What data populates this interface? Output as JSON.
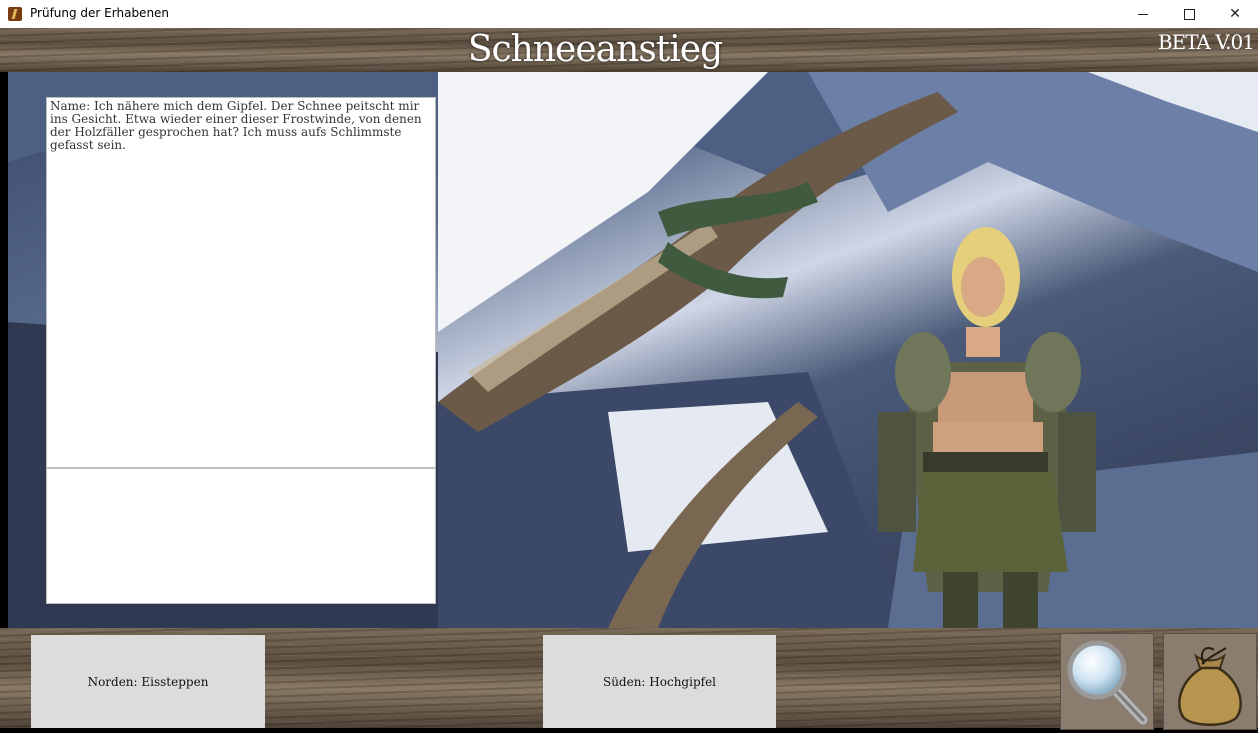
{
  "window": {
    "title": "Prüfung der Erhabenen",
    "minimize_icon": "minimize-icon",
    "maximize_icon": "maximize-icon",
    "close_icon": "close-icon",
    "close_glyph": "✕"
  },
  "header": {
    "scene_title": "Schneeanstieg",
    "version": "BETA V.01"
  },
  "panel": {
    "narration": "Name: Ich nähere mich dem Gipfel. Der Schnee peitscht mir ins Gesicht. Etwa wieder einer dieser Frostwinde, von denen der Holzfäller gesprochen hat? Ich muss aufs Schlimmste gefasst sein."
  },
  "navigation": {
    "north_label": "Norden: Eissteppen",
    "south_label": "Süden: Hochgipfel"
  },
  "tools": {
    "search_icon": "magnifier-icon",
    "bag_icon": "inventory-bag-icon"
  },
  "colors": {
    "panel_bg": "#ffffff",
    "button_bg": "#dcdcdc",
    "title_text": "#ffffff"
  }
}
